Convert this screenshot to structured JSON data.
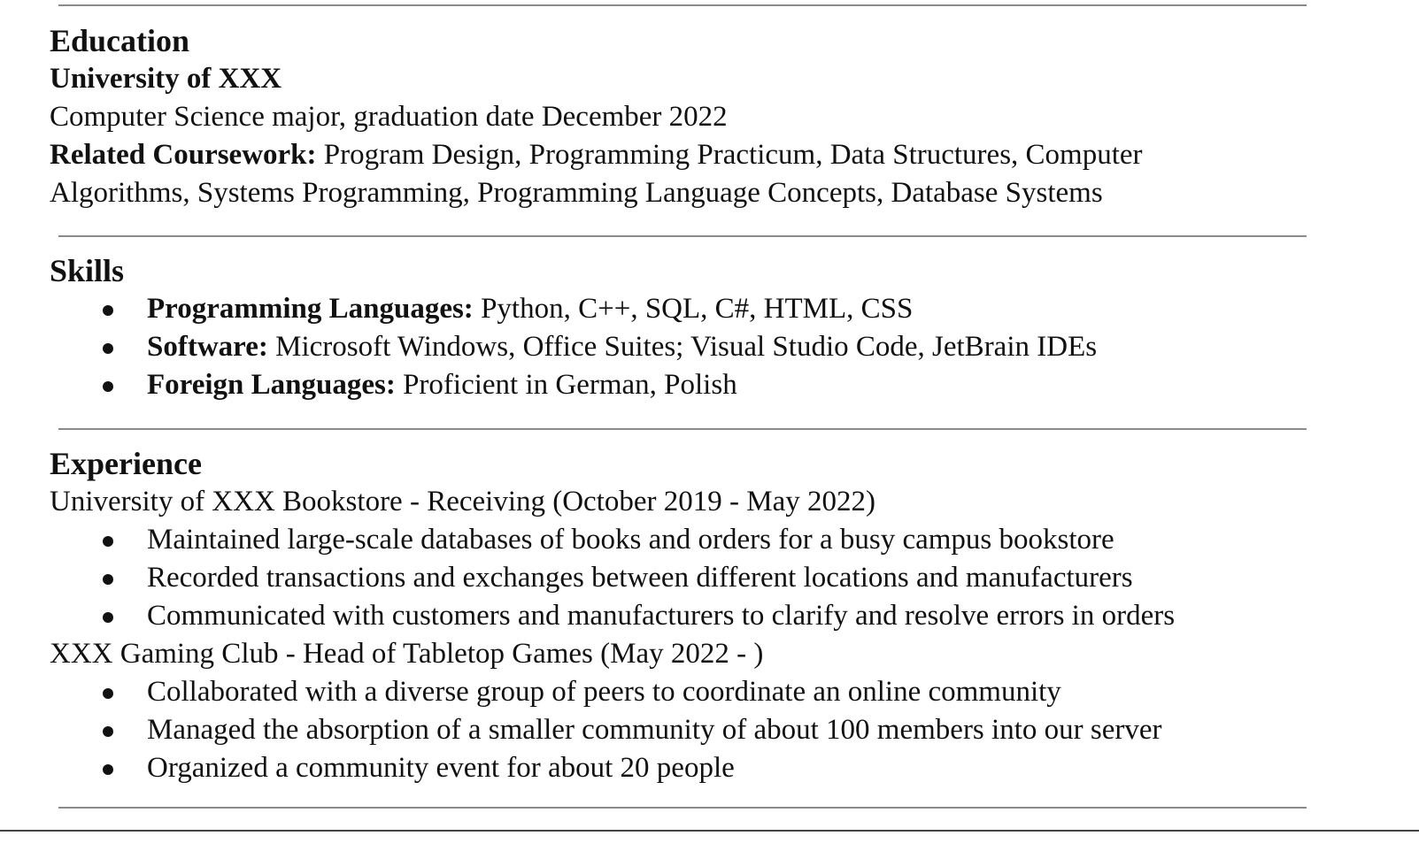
{
  "education": {
    "heading": "Education",
    "school": "University of XXX",
    "major": "Computer Science major, graduation date December 2022",
    "coursework_label": "Related Coursework:",
    "coursework_text": " Program Design, Programming Practicum, Data Structures, Computer Algorithms, Systems Programming, Programming Language Concepts, Database Systems"
  },
  "skills": {
    "heading": "Skills",
    "items": [
      {
        "label": "Programming Languages:",
        "text": " Python, C++, SQL, C#, HTML, CSS"
      },
      {
        "label": "Software:",
        "text": " Microsoft Windows, Office Suites; Visual Studio Code, JetBrain IDEs"
      },
      {
        "label": "Foreign Languages:",
        "text": " Proficient in German, Polish"
      }
    ]
  },
  "experience": {
    "heading": "Experience",
    "jobs": [
      {
        "title": "University of XXX Bookstore - Receiving (October 2019 - May 2022)",
        "bullets": [
          "Maintained large-scale databases of books and orders for a busy campus bookstore",
          "Recorded transactions and exchanges between different locations and manufacturers",
          "Communicated with customers and manufacturers to clarify and resolve errors in orders"
        ]
      },
      {
        "title": "XXX Gaming Club - Head of Tabletop Games (May 2022 - )",
        "bullets": [
          "Collaborated with a diverse group of peers to coordinate an online community",
          "Managed the absorption of a smaller community of about 100 members into our server",
          "Organized a community event for about 20 people"
        ]
      }
    ]
  },
  "colors": {
    "text": "#111111",
    "rule": "#8a8a8a",
    "background": "#ffffff"
  }
}
